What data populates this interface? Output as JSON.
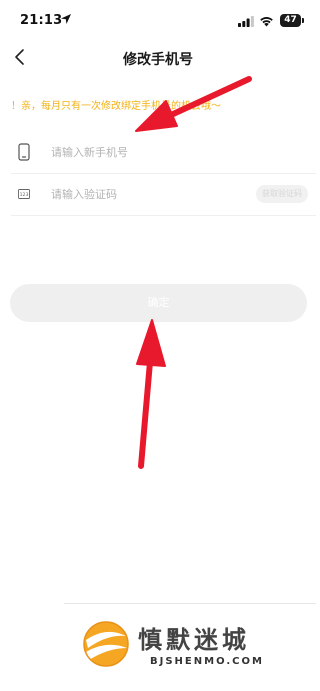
{
  "status_bar": {
    "time": "21:13",
    "battery": "47"
  },
  "header": {
    "title": "修改手机号"
  },
  "notice": {
    "text": "！亲，每月只有一次修改绑定手机号的机会哦～"
  },
  "form": {
    "phone": {
      "placeholder": "请输入新手机号"
    },
    "code": {
      "placeholder": "请输入验证码",
      "button_label": "获取验证码"
    }
  },
  "confirm_label": "确定",
  "watermark": {
    "name": "慎默迷城",
    "domain": "BJSHENMO.COM"
  },
  "colors": {
    "notice": "#f2b216",
    "arrow": "#e8192c",
    "button_disabled": "#efefef"
  }
}
